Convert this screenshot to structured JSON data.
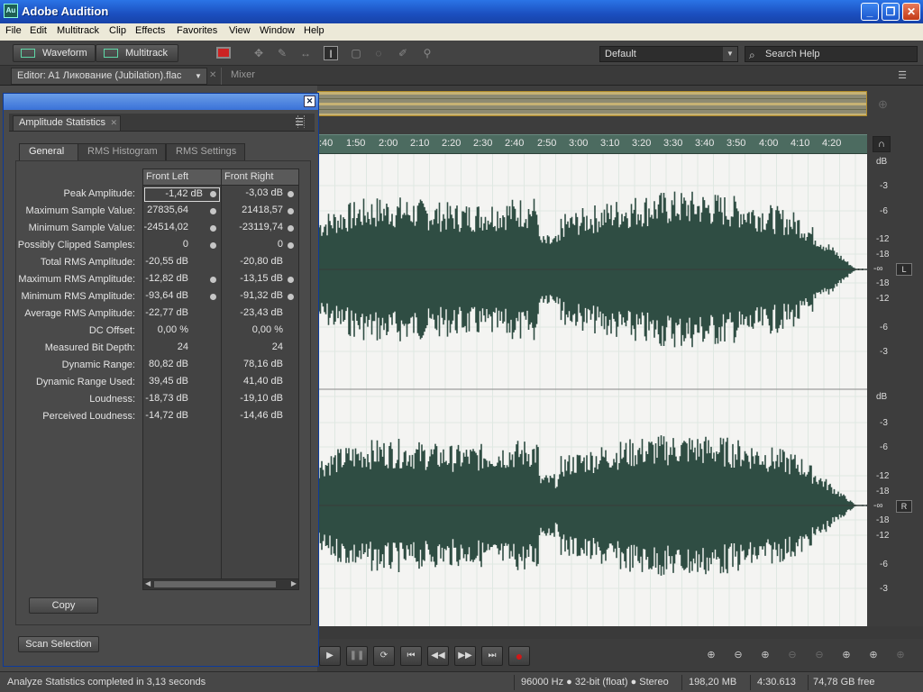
{
  "window": {
    "title": "Adobe Audition",
    "app_icon": "Au",
    "min": "_",
    "max": "❐",
    "close": "✕"
  },
  "menu": [
    "File",
    "Edit",
    "Multitrack",
    "Clip",
    "Effects",
    "Favorites",
    "View",
    "Window",
    "Help"
  ],
  "toolbar": {
    "waveform_label": "Waveform",
    "multitrack_label": "Multitrack",
    "workspace_value": "Default",
    "search_placeholder": "Search Help"
  },
  "editor_tabs": {
    "editor_label": "Editor: A1 Ликование (Jubilation).flac",
    "mixer_label": "Mixer"
  },
  "panel": {
    "title": "Amplitude Statistics",
    "tabs": [
      "General",
      "RMS Histogram",
      "RMS Settings"
    ],
    "columns": [
      "Front Left",
      "Front Right"
    ],
    "rows": [
      {
        "label": "Peak Amplitude:",
        "left": "-1,42 dB",
        "right": "-3,03 dB",
        "pin": true
      },
      {
        "label": "Maximum Sample Value:",
        "left": "27835,64",
        "right": "21418,57",
        "pin": true
      },
      {
        "label": "Minimum Sample Value:",
        "left": "-24514,02",
        "right": "-23119,74",
        "pin": true
      },
      {
        "label": "Possibly Clipped Samples:",
        "left": "0",
        "right": "0",
        "pin": true
      },
      {
        "label": "Total RMS Amplitude:",
        "left": "-20,55 dB",
        "right": "-20,80 dB",
        "pin": false
      },
      {
        "label": "Maximum RMS Amplitude:",
        "left": "-12,82 dB",
        "right": "-13,15 dB",
        "pin": true
      },
      {
        "label": "Minimum RMS Amplitude:",
        "left": "-93,64 dB",
        "right": "-91,32 dB",
        "pin": true
      },
      {
        "label": "Average RMS Amplitude:",
        "left": "-22,77 dB",
        "right": "-23,43 dB",
        "pin": false
      },
      {
        "label": "DC Offset:",
        "left": "0,00 %",
        "right": "0,00 %",
        "pin": false
      },
      {
        "label": "Measured Bit Depth:",
        "left": "24",
        "right": "24",
        "pin": false
      },
      {
        "label": "Dynamic Range:",
        "left": "80,82 dB",
        "right": "78,16 dB",
        "pin": false
      },
      {
        "label": "Dynamic Range Used:",
        "left": "39,45 dB",
        "right": "41,40 dB",
        "pin": false
      },
      {
        "label": "Loudness:",
        "left": "-18,73 dB",
        "right": "-19,10 dB",
        "pin": false
      },
      {
        "label": "Perceived Loudness:",
        "left": "-14,72 dB",
        "right": "-14,46 dB",
        "pin": false
      }
    ],
    "copy_label": "Copy",
    "scan_label": "Scan Selection"
  },
  "timeline": [
    ":40",
    "1:50",
    "2:00",
    "2:10",
    "2:20",
    "2:30",
    "2:40",
    "2:50",
    "3:00",
    "3:10",
    "3:20",
    "3:30",
    "3:40",
    "3:50",
    "4:00",
    "4:10",
    "4:20"
  ],
  "db_ruler": {
    "unit": "dB",
    "top_channel": [
      "-3",
      "-6",
      "-12",
      "-18",
      "-∞",
      "-18",
      "-12",
      "-6",
      "-3"
    ],
    "bottom_channel": [
      "-3",
      "-6",
      "-12",
      "-18",
      "-∞",
      "-18",
      "-12",
      "-6",
      "-3"
    ],
    "left_badge": "L",
    "right_badge": "R"
  },
  "status": {
    "message": "Analyze Statistics completed in 3,13 seconds",
    "format": "96000 Hz ● 32-bit (float) ● Stereo",
    "size": "198,20 MB",
    "duration": "4:30.613",
    "free": "74,78 GB free"
  },
  "colors": {
    "waveform": "#2f4d43",
    "timeline": "#4c6b60",
    "overview": "#c6b274",
    "record": "#d01818"
  }
}
